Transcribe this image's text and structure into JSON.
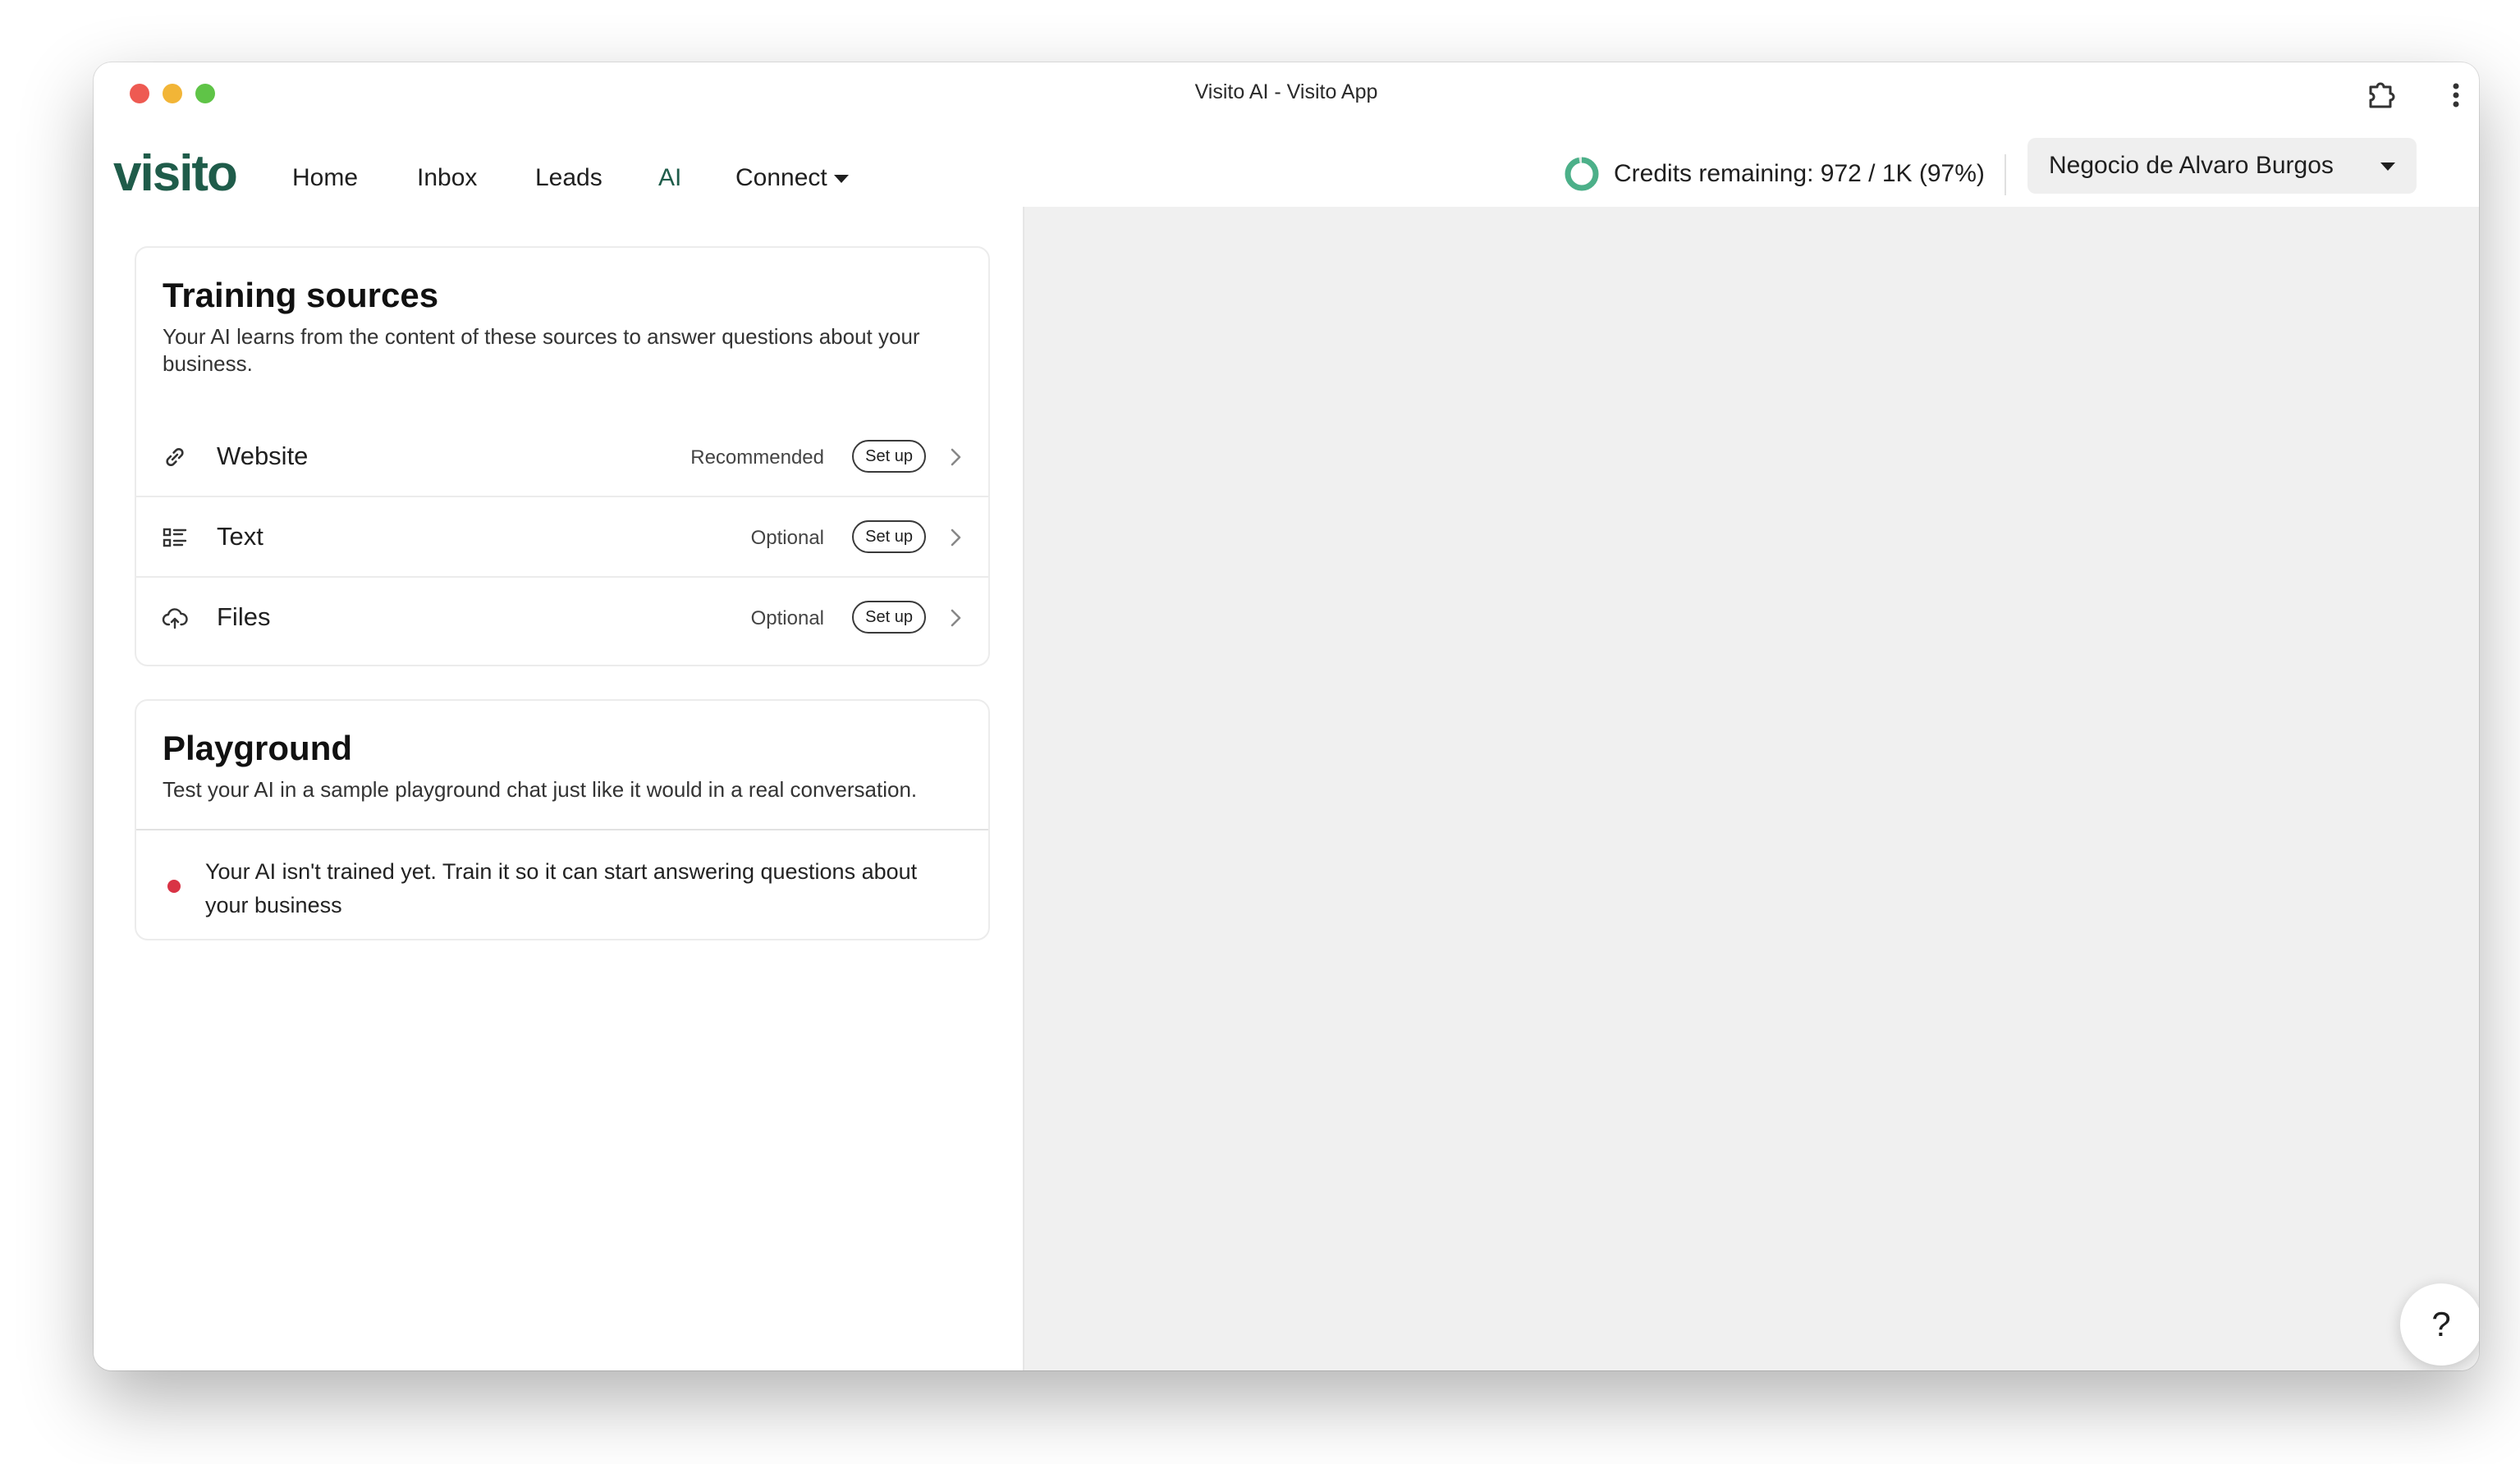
{
  "window": {
    "title": "Visito AI - Visito App"
  },
  "navbar": {
    "logo": "visito",
    "items": [
      {
        "label": "Home"
      },
      {
        "label": "Inbox"
      },
      {
        "label": "Leads"
      },
      {
        "label": "AI",
        "active": true
      },
      {
        "label": "Connect"
      }
    ],
    "credits": "Credits remaining: 972 / 1K (97%)",
    "credits_fraction": 0.97,
    "business": "Negocio de Alvaro Burgos"
  },
  "training": {
    "title": "Training sources",
    "description": "Your AI learns from the content of these sources to answer questions about your business.",
    "sources": [
      {
        "label": "Website",
        "status": "Recommended",
        "button": "Set up",
        "icon": "link-icon"
      },
      {
        "label": "Text",
        "status": "Optional",
        "button": "Set up",
        "icon": "text-list-icon"
      },
      {
        "label": "Files",
        "status": "Optional",
        "button": "Set up",
        "icon": "cloud-upload-icon"
      }
    ]
  },
  "playground": {
    "title": "Playground",
    "description": "Test your AI in a sample playground chat just like it would in a real conversation.",
    "status": "Your AI isn't trained yet. Train it so it can start answering questions about your business"
  },
  "help": {
    "label": "?"
  },
  "colors": {
    "brand": "#1f5c4a",
    "credits_ring": "#4cb089",
    "error_dot": "#d93345"
  }
}
